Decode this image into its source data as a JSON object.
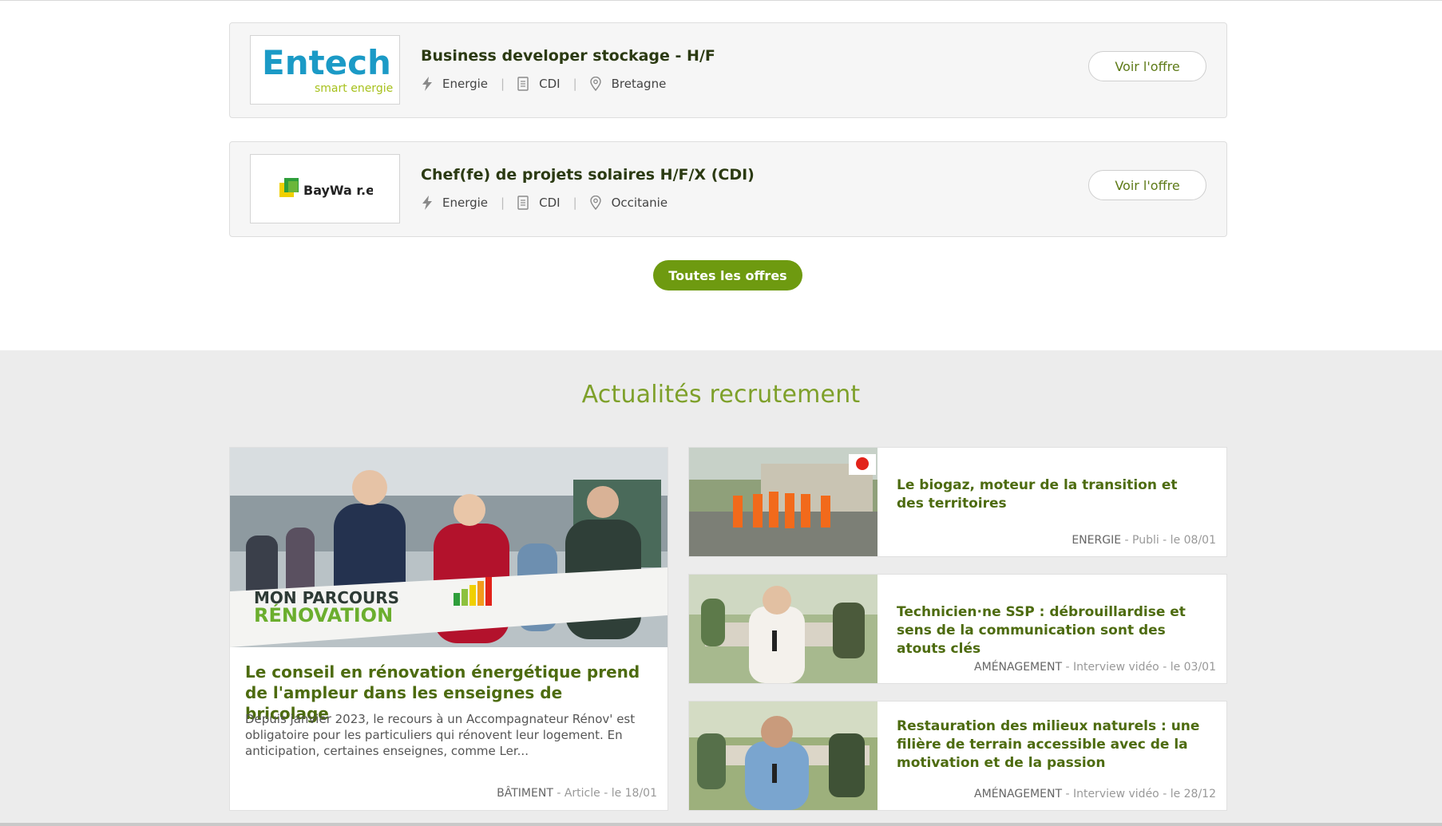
{
  "jobs": [
    {
      "logo_name": "Entech",
      "logo_text": "Entech",
      "logo_tagline": "smart energies",
      "title": "Business developer stockage - H/F",
      "sector": "Energie",
      "contract": "CDI",
      "location": "Bretagne",
      "button": "Voir l'offre"
    },
    {
      "logo_name": "BayWa r.e.",
      "logo_text": "BayWa r.e.",
      "title": "Chef(fe) de projets solaires H/F/X (CDI)",
      "sector": "Energie",
      "contract": "CDI",
      "location": "Occitanie",
      "button": "Voir l'offre"
    }
  ],
  "all_offers_button": "Toutes les offres",
  "news": {
    "heading": "Actualités recrutement",
    "feature": {
      "image_banner_1": "MON PARCOURS",
      "image_banner_2": "RÉNOVATION",
      "title": "Le conseil en rénovation énergétique prend de l'ampleur dans les enseignes de bricolage",
      "excerpt": "Depuis janvier 2023, le recours à un Accompagnateur Rénov' est obligatoire pour les particuliers qui rénovent leur logement. En anticipation, certaines enseignes, comme Ler...",
      "category": "BÂTIMENT",
      "meta": " - Article - le 18/01"
    },
    "items": [
      {
        "title": "Le biogaz, moteur de la transition et des territoires",
        "category": "ENERGIE",
        "meta": " - Publi - le 08/01"
      },
      {
        "title": "Technicien·ne SSP : débrouillardise et sens de la communication sont des atouts clés",
        "category": "AMÉNAGEMENT",
        "meta": " - Interview vidéo - le 03/01"
      },
      {
        "title": "Restauration des milieux naturels : une filière de terrain accessible avec de la motivation et de la passion",
        "category": "AMÉNAGEMENT",
        "meta": " - Interview vidéo - le 28/12"
      }
    ]
  },
  "colors": {
    "accent_green": "#6e9a10",
    "title_green": "#4d6b0f",
    "heading_green": "#7ea02a"
  },
  "icons": [
    "lightning-icon",
    "document-icon",
    "location-pin-icon"
  ]
}
